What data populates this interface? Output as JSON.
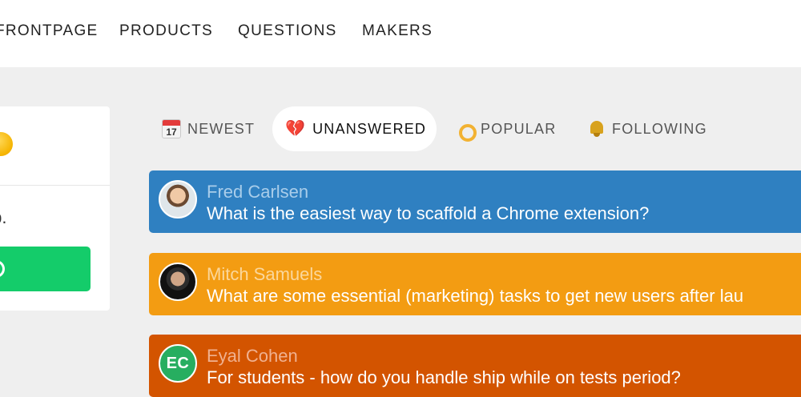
{
  "topnav": {
    "links": [
      "FRONTPAGE",
      "PRODUCTS",
      "QUESTIONS",
      "MAKERS"
    ]
  },
  "sidebar": {
    "text": "elp."
  },
  "tabs": [
    {
      "label": "NEWEST",
      "icon": "calendar-icon",
      "icon_text": "17",
      "active": false
    },
    {
      "label": "UNANSWERED",
      "icon": "broken-heart-icon",
      "active": true
    },
    {
      "label": "POPULAR",
      "icon": "ok-hand-icon",
      "active": false
    },
    {
      "label": "FOLLOWING",
      "icon": "bell-icon",
      "active": false
    }
  ],
  "questions": [
    {
      "author": "Fred Carlsen",
      "title": "What is the easiest way to scaffold a Chrome extension?",
      "color": "#2f80c1",
      "author_color": "#a9cdea"
    },
    {
      "author": "Mitch Samuels",
      "title": "What are some essential (marketing) tasks to get new users after lau",
      "color": "#f39c12",
      "author_color": "#fbd79c"
    },
    {
      "author": "Eyal Cohen",
      "title": "For students - how do you handle ship while on tests period?",
      "color": "#d35400",
      "author_color": "#f0b190",
      "initials": "EC"
    }
  ]
}
